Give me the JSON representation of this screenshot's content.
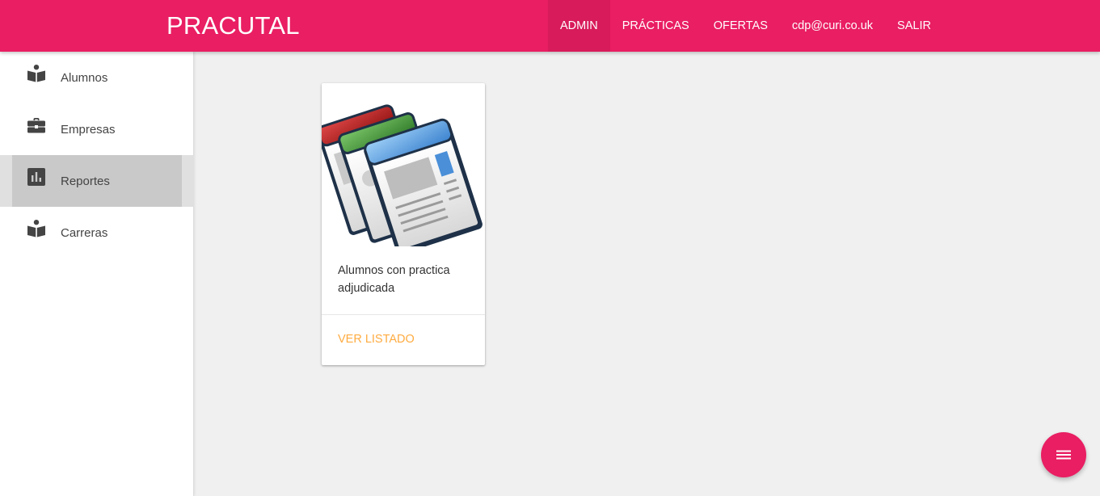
{
  "header": {
    "brand": "PRACUTAL",
    "menu": [
      {
        "label": "ADMIN",
        "active": true
      },
      {
        "label": "PRÁCTICAS"
      },
      {
        "label": "OFERTAS"
      },
      {
        "label": "cdp@curi.co.uk"
      },
      {
        "label": "SALIR"
      }
    ]
  },
  "sidebar": {
    "items": [
      {
        "label": "Alumnos",
        "icon": "reader-icon"
      },
      {
        "label": "Empresas",
        "icon": "briefcase-icon"
      },
      {
        "label": "Reportes",
        "icon": "bar-chart-icon",
        "active": true
      },
      {
        "label": "Carreras",
        "icon": "reader-icon"
      }
    ]
  },
  "main": {
    "cards": [
      {
        "title": "Alumnos con practica adjudicada",
        "action": "VER LISTADO",
        "image": "report-documents-icon"
      }
    ]
  },
  "fab": {
    "icon": "menu-icon"
  },
  "colors": {
    "primary": "#e91e63",
    "accent": "#ffab40",
    "background": "#f0f0f0"
  }
}
